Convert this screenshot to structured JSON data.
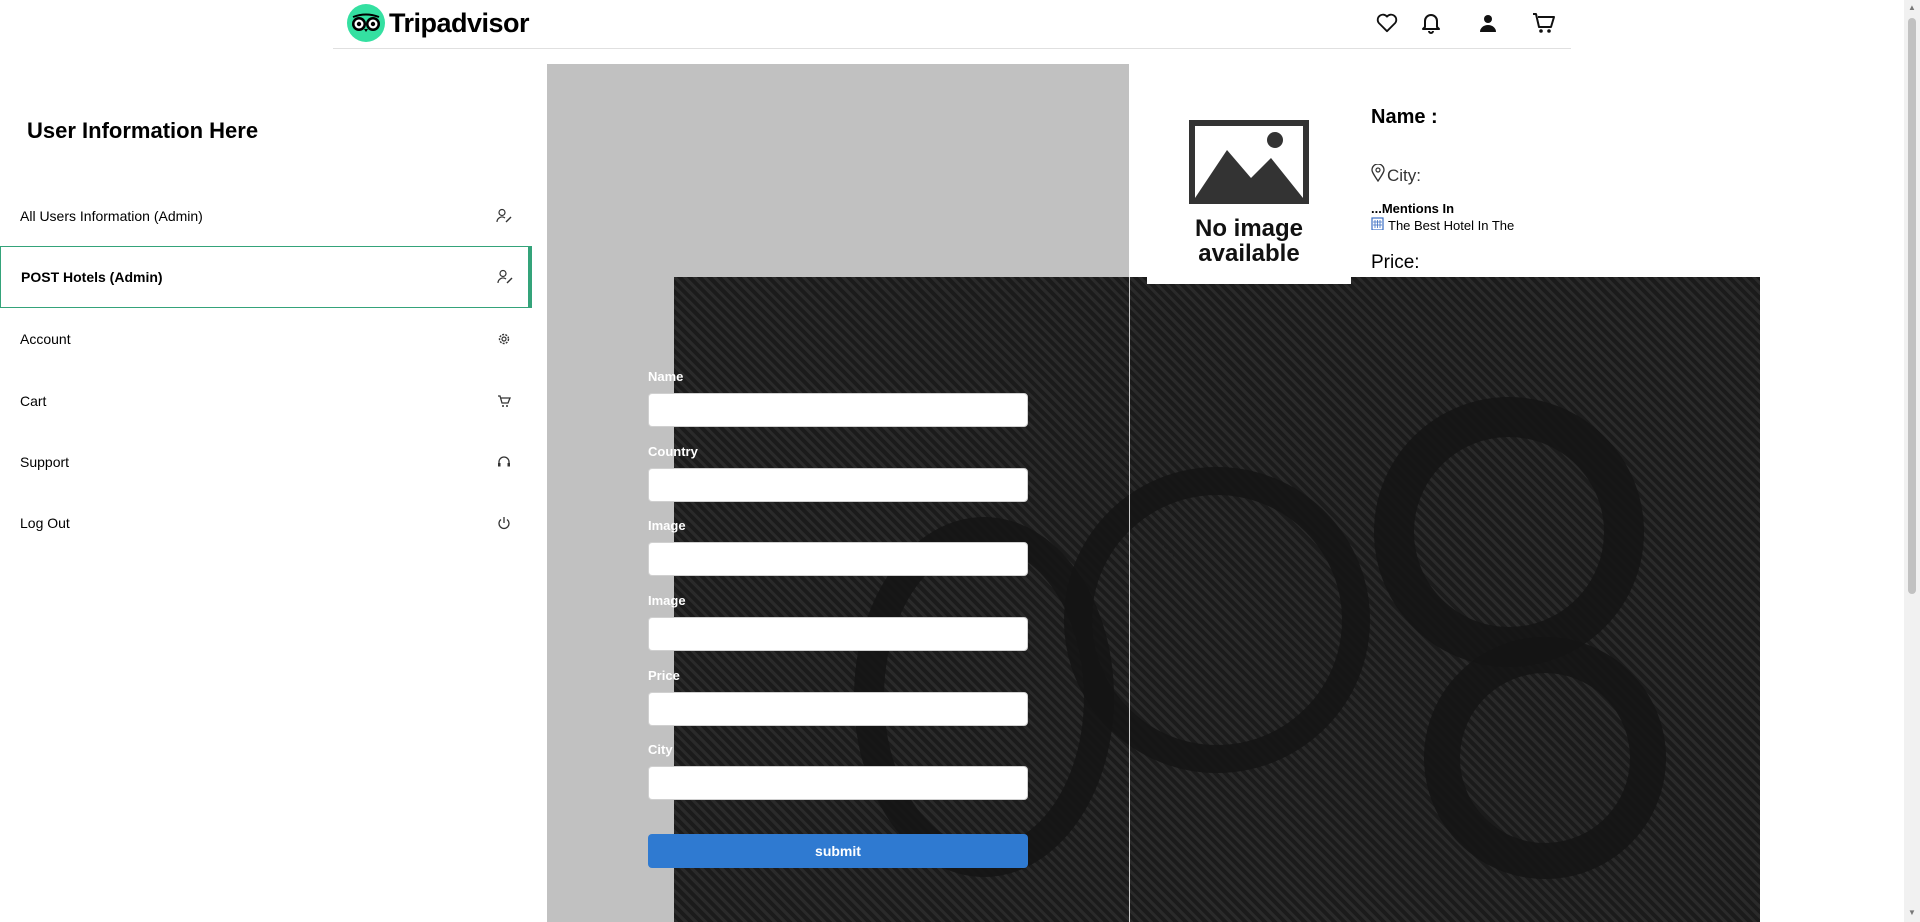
{
  "header": {
    "brand": "Tripadvisor",
    "icons": [
      "heart-icon",
      "bell-icon",
      "user-icon",
      "cart-icon"
    ]
  },
  "sidebar": {
    "title": "User Information Here",
    "items": [
      {
        "label": "All Users Information (Admin)",
        "icon": "user-edit-icon",
        "active": false
      },
      {
        "label": "POST Hotels (Admin)",
        "icon": "user-edit-icon",
        "active": true
      },
      {
        "label": "Account",
        "icon": "gear-icon",
        "active": false
      },
      {
        "label": "Cart",
        "icon": "cart-icon",
        "active": false
      },
      {
        "label": "Support",
        "icon": "headset-icon",
        "active": false
      },
      {
        "label": "Log Out",
        "icon": "power-icon",
        "active": false
      }
    ]
  },
  "hotel_card": {
    "image_text": "No image available",
    "name_label": "Name :",
    "city_label": "City:",
    "mentions": "...Mentions In",
    "best_hotel": "The Best Hotel In The",
    "price_label": "Price:"
  },
  "form": {
    "fields": [
      {
        "label": "Name",
        "value": ""
      },
      {
        "label": "Country",
        "value": ""
      },
      {
        "label": "Image",
        "value": ""
      },
      {
        "label": "Image",
        "value": ""
      },
      {
        "label": "Price",
        "value": ""
      },
      {
        "label": "City",
        "value": ""
      }
    ],
    "submit_label": "submit"
  },
  "colors": {
    "brand_green": "#34e0a1",
    "active_border": "#34a37a",
    "submit_blue": "#2f7ad1",
    "panel_gray": "#c1c1c1"
  }
}
